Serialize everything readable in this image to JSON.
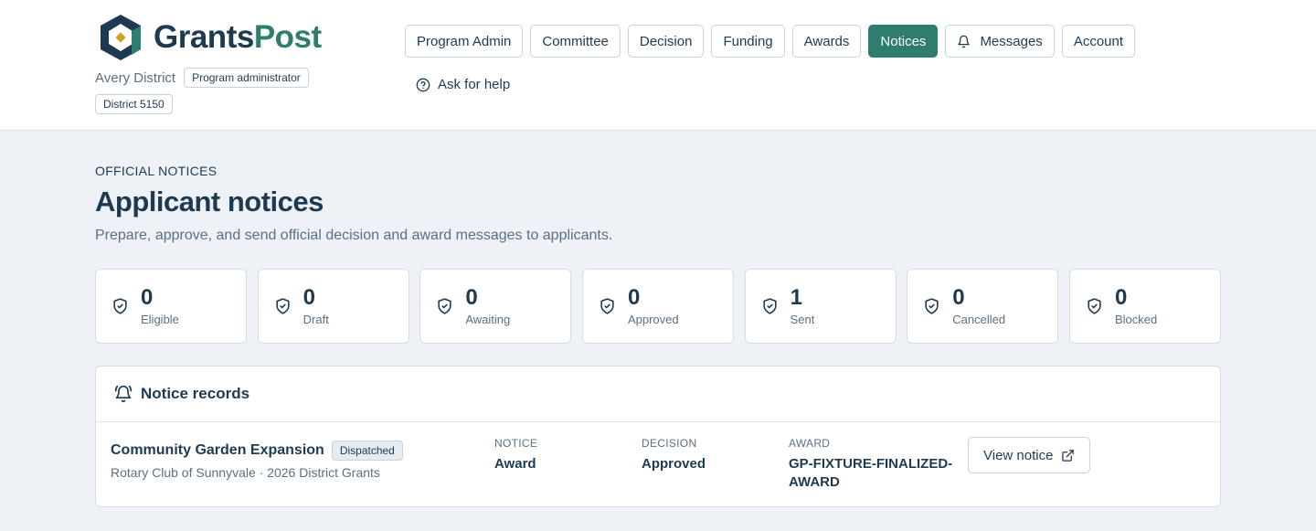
{
  "brand": {
    "part1": "Grants",
    "part2": "Post",
    "icon": "grantspost-logo-icon",
    "accent": "#2e7d6e",
    "dark": "#1e3a52"
  },
  "org": {
    "name": "Avery District",
    "role": "Program administrator",
    "district": "District 5150"
  },
  "nav": {
    "items": [
      "Program Admin",
      "Committee",
      "Decision",
      "Funding",
      "Awards",
      "Notices"
    ],
    "active": "Notices",
    "messages": "Messages",
    "account": "Account",
    "help": "Ask for help"
  },
  "page": {
    "eyebrow": "OFFICIAL NOTICES",
    "title": "Applicant notices",
    "subtitle": "Prepare, approve, and send official decision and award messages to applicants."
  },
  "stats": [
    {
      "value": "0",
      "label": "Eligible"
    },
    {
      "value": "0",
      "label": "Draft"
    },
    {
      "value": "0",
      "label": "Awaiting"
    },
    {
      "value": "0",
      "label": "Approved"
    },
    {
      "value": "1",
      "label": "Sent"
    },
    {
      "value": "0",
      "label": "Cancelled"
    },
    {
      "value": "0",
      "label": "Blocked"
    }
  ],
  "records": {
    "title": "Notice records",
    "rows": [
      {
        "project": "Community Garden Expansion",
        "status": "Dispatched",
        "meta": "Rotary Club of Sunnyvale · 2026 District Grants",
        "notice_label": "NOTICE",
        "notice": "Award",
        "decision_label": "DECISION",
        "decision": "Approved",
        "award_label": "AWARD",
        "award": "GP-FIXTURE-FINALIZED-AWARD",
        "action": "View notice"
      }
    ]
  }
}
